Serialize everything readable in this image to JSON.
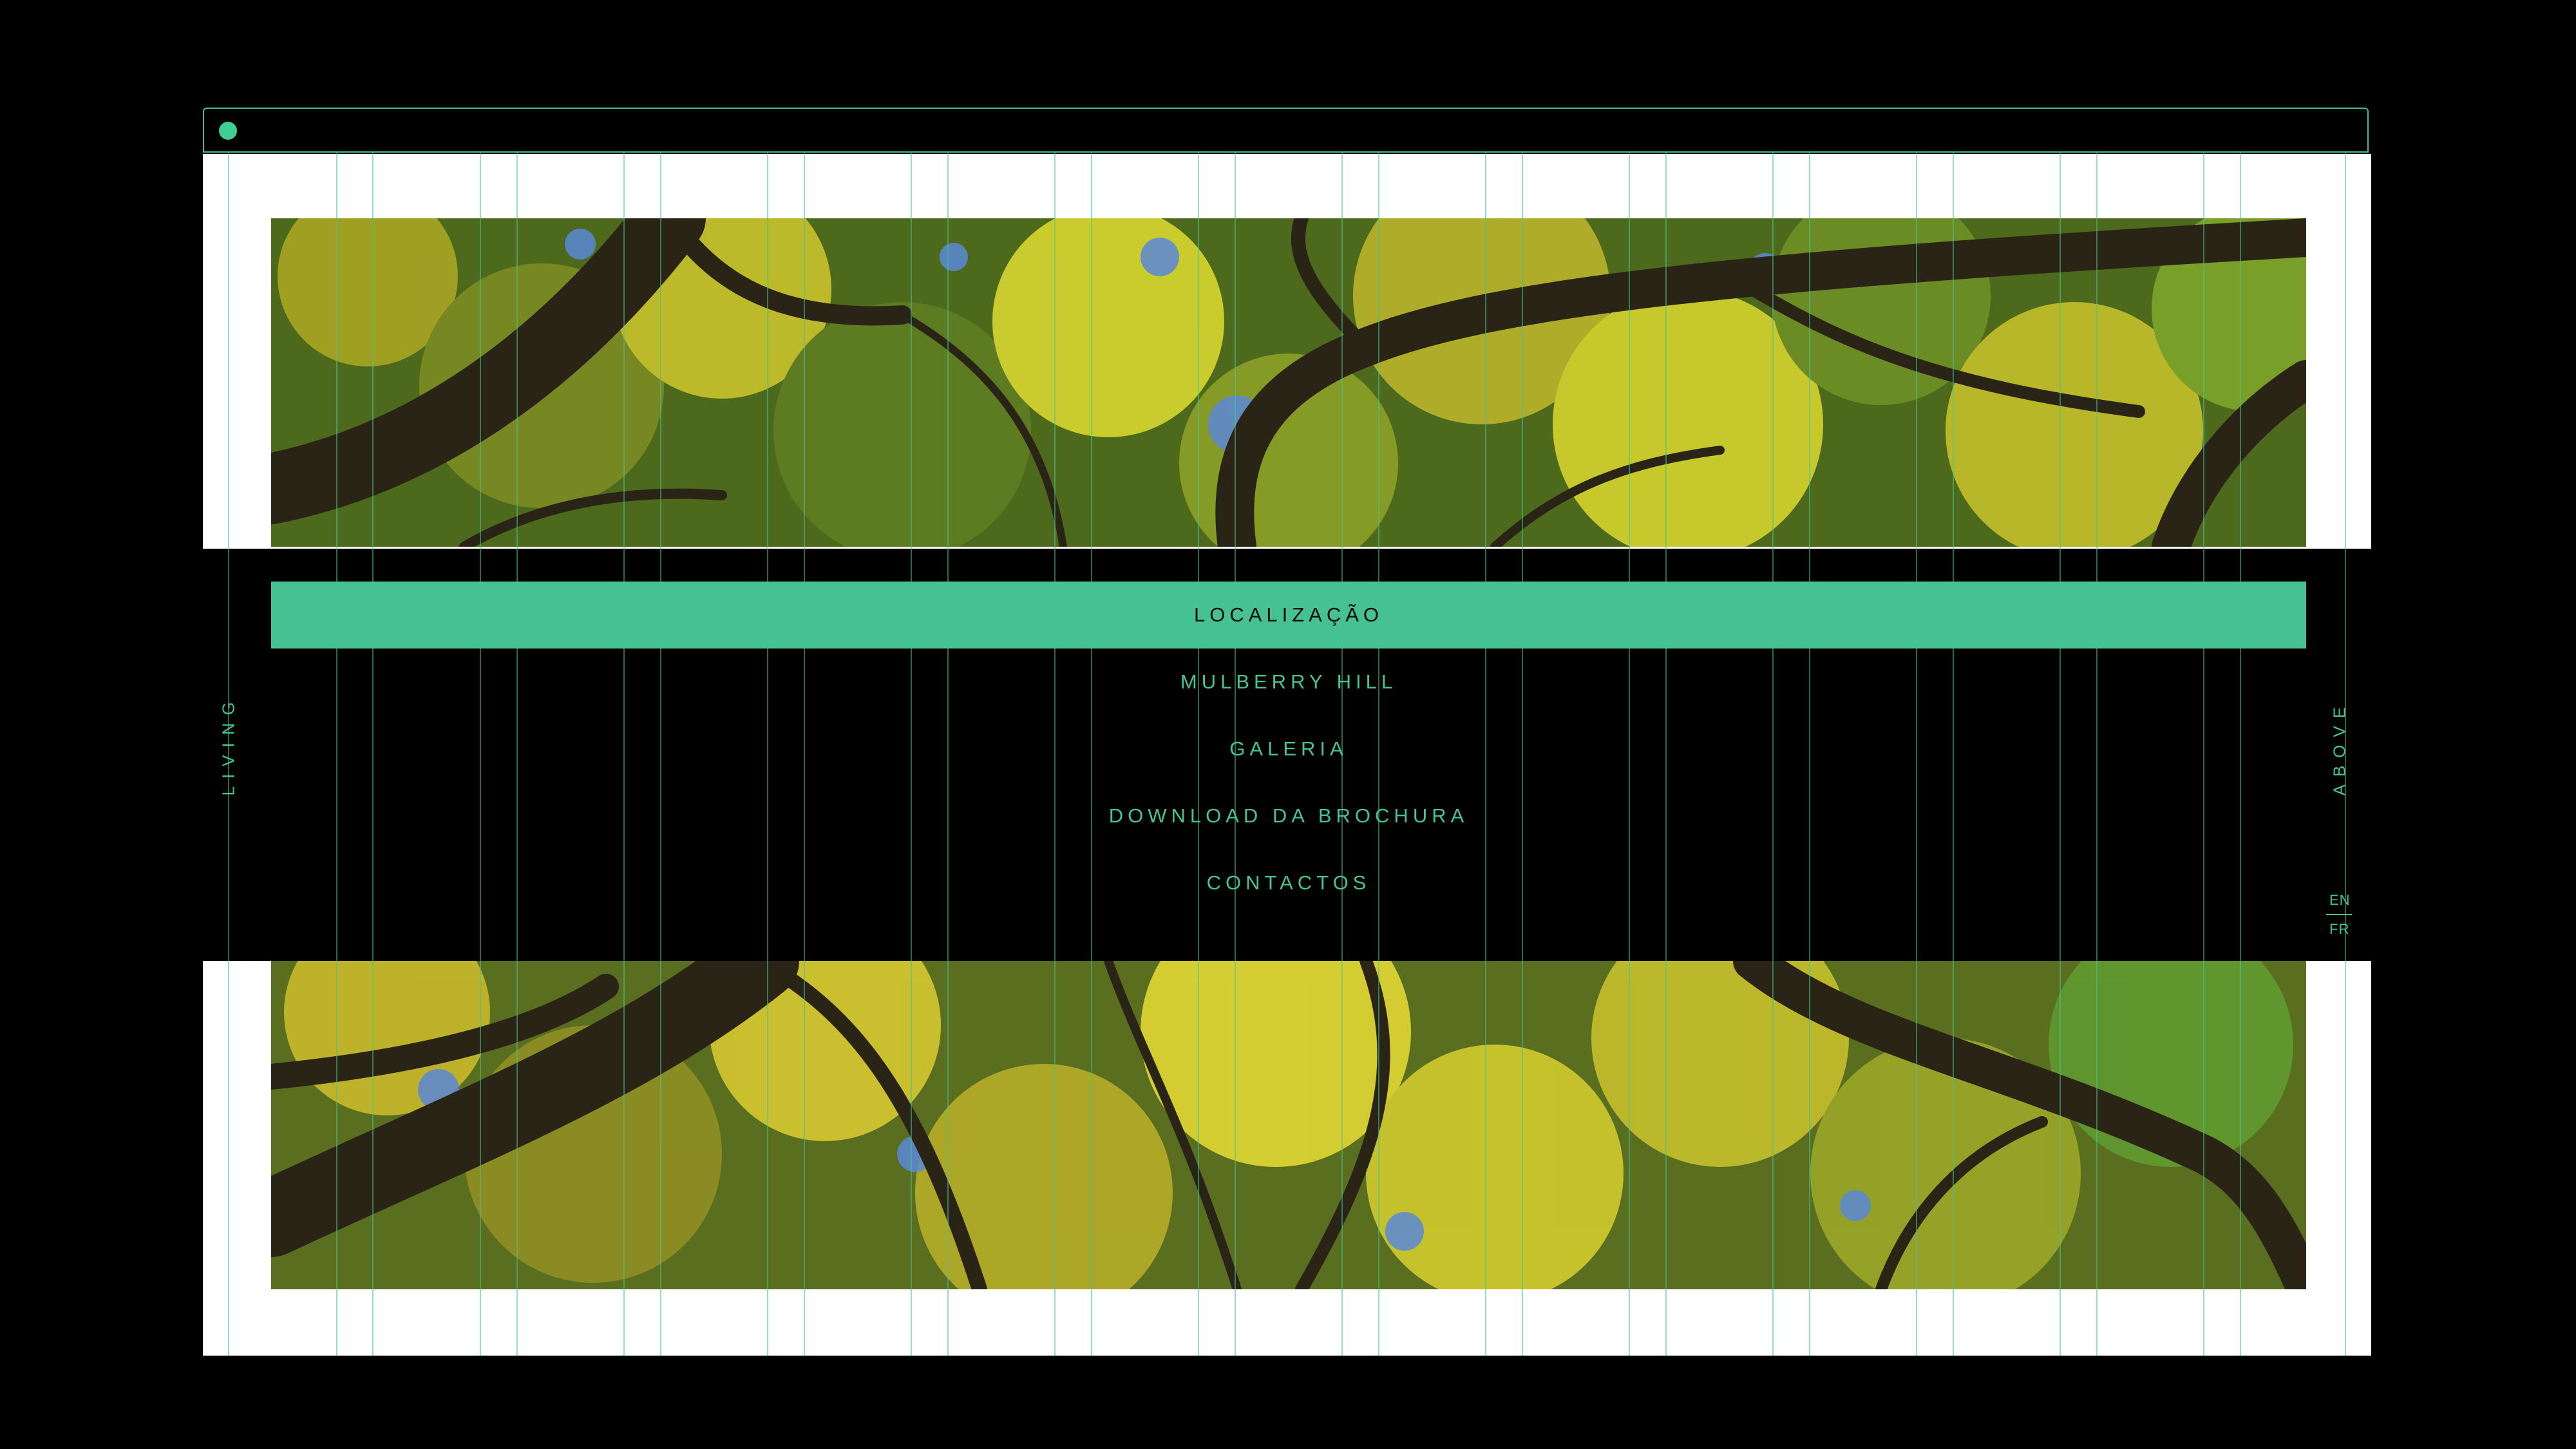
{
  "browser": {
    "dot_color": "#3fcf92"
  },
  "nav": {
    "items": [
      {
        "label": "LOCALIZAÇÃO",
        "active": true
      },
      {
        "label": "MULBERRY HILL",
        "active": false
      },
      {
        "label": "GALERIA",
        "active": false
      },
      {
        "label": "DOWNLOAD DA BROCHURA",
        "active": false
      },
      {
        "label": "CONTACTOS",
        "active": false
      }
    ]
  },
  "side": {
    "left_word": "LIVING",
    "right_word": "ABOVE"
  },
  "languages": {
    "en": "EN",
    "fr": "FR"
  },
  "colors": {
    "accent": "#46c194",
    "background": "#000000",
    "frame": "#ffffff"
  }
}
